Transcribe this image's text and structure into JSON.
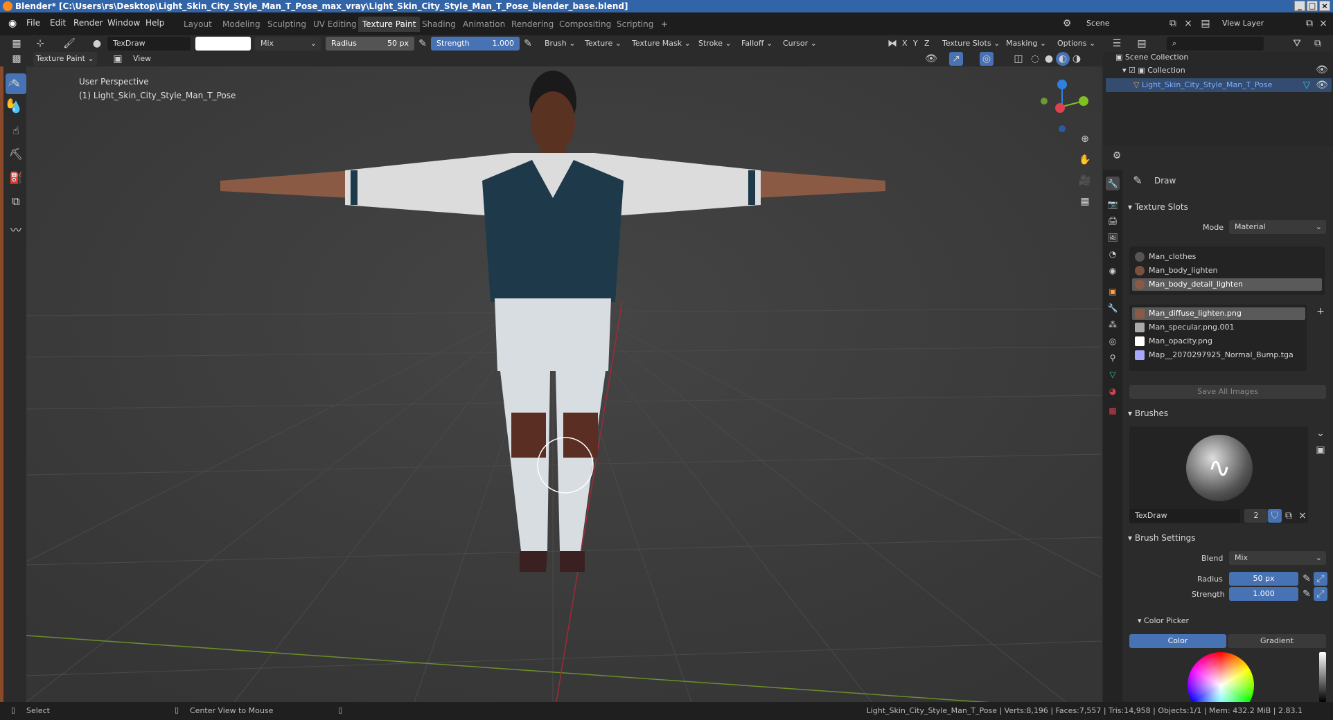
{
  "window": {
    "title": "Blender* [C:\\Users\\rs\\Desktop\\Light_Skin_City_Style_Man_T_Pose_max_vray\\Light_Skin_City_Style_Man_T_Pose_blender_base.blend]"
  },
  "menus": [
    "File",
    "Edit",
    "Render",
    "Window",
    "Help"
  ],
  "workspaces": [
    "Layout",
    "Modeling",
    "Sculpting",
    "UV Editing",
    "Texture Paint",
    "Shading",
    "Animation",
    "Rendering",
    "Compositing",
    "Scripting"
  ],
  "active_workspace": "Texture Paint",
  "scene": {
    "name": "Scene",
    "view_layer": "View Layer"
  },
  "tool_header": {
    "brush_name": "TexDraw",
    "blend": "Mix",
    "radius_label": "Radius",
    "radius_value": "50 px",
    "strength_label": "Strength",
    "strength_value": "1.000",
    "dropdowns": [
      "Brush",
      "Texture",
      "Texture Mask",
      "Stroke",
      "Falloff",
      "Cursor"
    ],
    "axis": [
      "X",
      "Y",
      "Z"
    ],
    "right_dropdowns": [
      "Texture Slots",
      "Masking",
      "Options"
    ]
  },
  "viewport_header": {
    "mode": "Texture Paint",
    "view": "View"
  },
  "viewport": {
    "perspective": "User Perspective",
    "object": "(1) Light_Skin_City_Style_Man_T_Pose"
  },
  "outliner": {
    "root": "Scene Collection",
    "collection": "Collection",
    "object": "Light_Skin_City_Style_Man_T_Pose"
  },
  "properties": {
    "tool_name": "Draw",
    "texture_slots": {
      "title": "Texture Slots",
      "mode_label": "Mode",
      "mode_value": "Material",
      "materials": [
        "Man_clothes",
        "Man_body_lighten",
        "Man_body_detail_lighten"
      ],
      "selected_material": 2,
      "images": [
        "Man_diffuse_lighten.png",
        "Man_specular.png.001",
        "Man_opacity.png",
        "Map__2070297925_Normal_Bump.tga"
      ],
      "selected_image": 0,
      "save_all": "Save All Images"
    },
    "brushes": {
      "title": "Brushes",
      "name": "TexDraw",
      "users": "2"
    },
    "brush_settings": {
      "title": "Brush Settings",
      "blend_label": "Blend",
      "blend_value": "Mix",
      "radius_label": "Radius",
      "radius_value": "50 px",
      "strength_label": "Strength",
      "strength_value": "1.000"
    },
    "color_picker": {
      "title": "Color Picker",
      "tab_color": "Color",
      "tab_gradient": "Gradient"
    }
  },
  "status": {
    "select": "Select",
    "center": "Center View to Mouse",
    "stats": "Light_Skin_City_Style_Man_T_Pose | Verts:8,196 | Faces:7,557 | Tris:14,958 | Objects:1/1 | Mem: 432.2 MiB | 2.83.1"
  },
  "colors": {
    "accent": "#4772b3",
    "axis_x": "#e04050",
    "axis_y": "#80c020",
    "axis_z": "#3080e0"
  }
}
